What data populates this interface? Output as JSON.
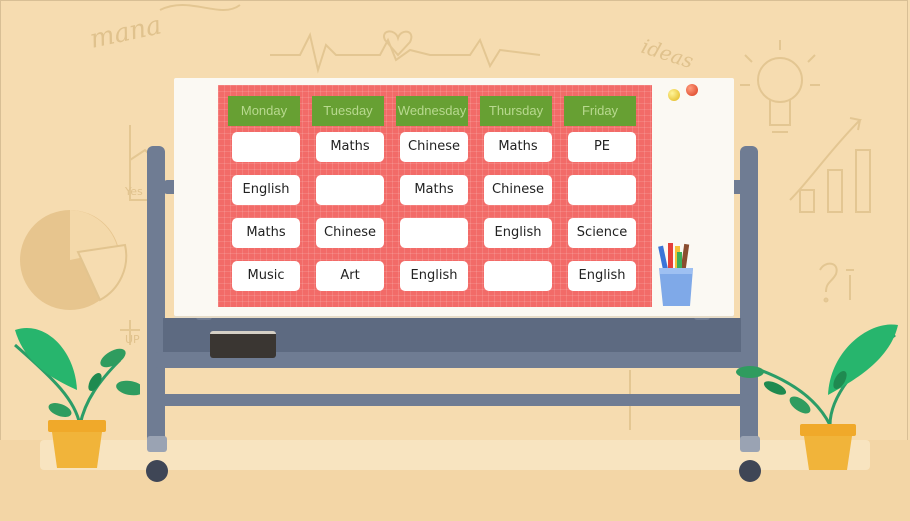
{
  "doodles": {
    "word_left": "mana",
    "word_right": "ideas",
    "small_yes": "Yes",
    "small_up": "UP"
  },
  "schedule": {
    "days": [
      "Monday",
      "Tuesday",
      "Wednesday",
      "Thursday",
      "Friday"
    ],
    "rows": [
      [
        "",
        "Maths",
        "Chinese",
        "Maths",
        "PE"
      ],
      [
        "English",
        "",
        "Maths",
        "Chinese",
        ""
      ],
      [
        "Maths",
        "Chinese",
        "",
        "English",
        "Science"
      ],
      [
        "Music",
        "Art",
        "English",
        "",
        "English"
      ]
    ]
  },
  "colors": {
    "board_grid": "#f26b68",
    "day_header": "#67a033",
    "day_text": "#b8d98f",
    "stand": "#6f7c93",
    "background": "#f6dcb0"
  },
  "icons": [
    "lightbulb-icon",
    "pie-chart-icon",
    "bar-chart-icon",
    "heartbeat-line-icon",
    "magnet-icon",
    "marker-cup-icon",
    "plant-icon",
    "eraser-icon"
  ]
}
